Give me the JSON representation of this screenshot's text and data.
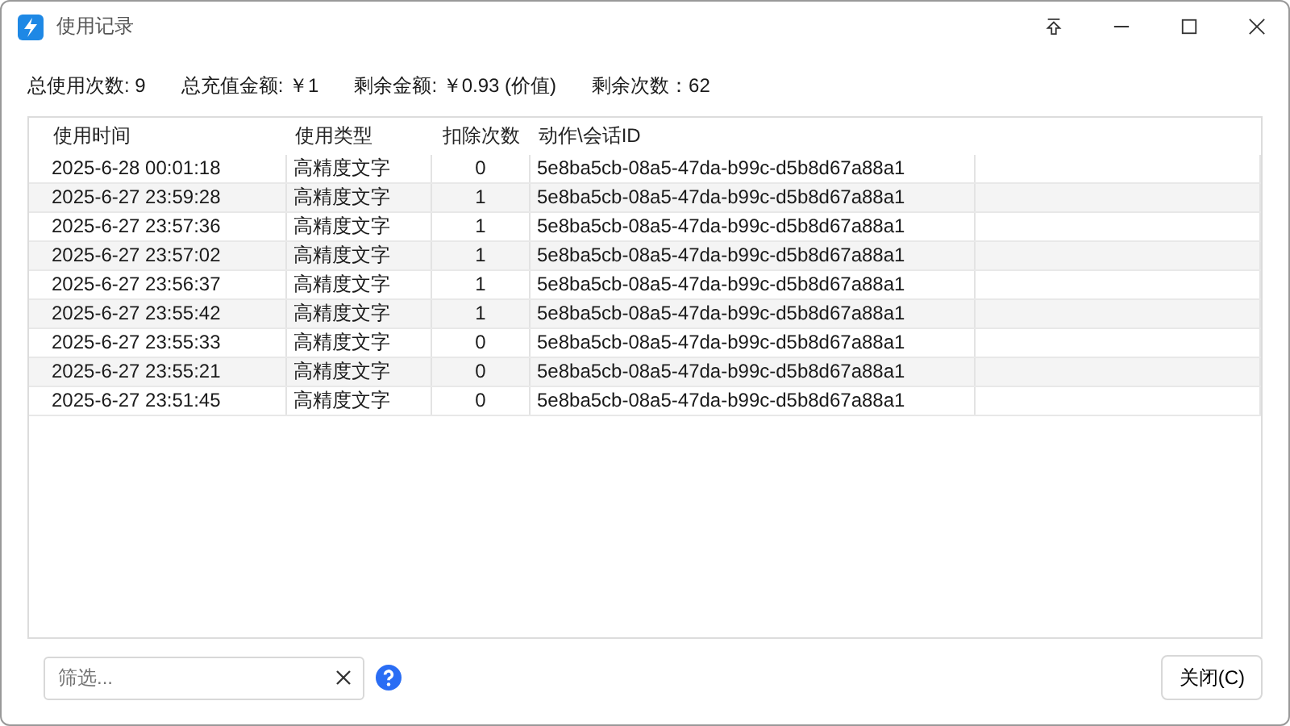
{
  "window": {
    "title": "使用记录"
  },
  "stats": [
    "总使用次数: 9",
    "总充值金额: ￥1",
    "剩余金额: ￥0.93 (价值)",
    "剩余次数：62"
  ],
  "table": {
    "columns": [
      "使用时间",
      "使用类型",
      "扣除次数",
      "动作\\会话ID"
    ],
    "rows": [
      [
        "2025-6-28 00:01:18",
        "高精度文字",
        "0",
        "5e8ba5cb-08a5-47da-b99c-d5b8d67a88a1"
      ],
      [
        "2025-6-27 23:59:28",
        "高精度文字",
        "1",
        "5e8ba5cb-08a5-47da-b99c-d5b8d67a88a1"
      ],
      [
        "2025-6-27 23:57:36",
        "高精度文字",
        "1",
        "5e8ba5cb-08a5-47da-b99c-d5b8d67a88a1"
      ],
      [
        "2025-6-27 23:57:02",
        "高精度文字",
        "1",
        "5e8ba5cb-08a5-47da-b99c-d5b8d67a88a1"
      ],
      [
        "2025-6-27 23:56:37",
        "高精度文字",
        "1",
        "5e8ba5cb-08a5-47da-b99c-d5b8d67a88a1"
      ],
      [
        "2025-6-27 23:55:42",
        "高精度文字",
        "1",
        "5e8ba5cb-08a5-47da-b99c-d5b8d67a88a1"
      ],
      [
        "2025-6-27 23:55:33",
        "高精度文字",
        "0",
        "5e8ba5cb-08a5-47da-b99c-d5b8d67a88a1"
      ],
      [
        "2025-6-27 23:55:21",
        "高精度文字",
        "0",
        "5e8ba5cb-08a5-47da-b99c-d5b8d67a88a1"
      ],
      [
        "2025-6-27 23:51:45",
        "高精度文字",
        "0",
        "5e8ba5cb-08a5-47da-b99c-d5b8d67a88a1"
      ]
    ]
  },
  "filter": {
    "placeholder": "筛选..."
  },
  "buttons": [
    "关闭(C)"
  ]
}
